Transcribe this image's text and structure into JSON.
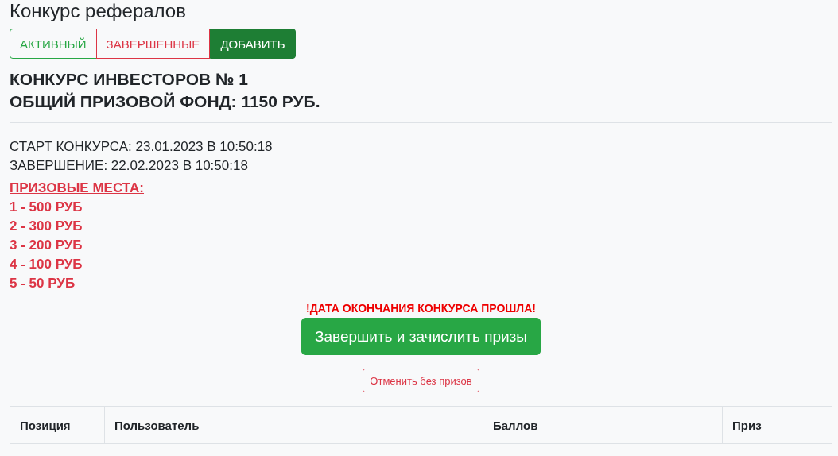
{
  "page": {
    "title": "Конкурс рефералов"
  },
  "nav_buttons": [
    {
      "label": "АКТИВНЫЙ",
      "kind": "outline-success"
    },
    {
      "label": "ЗАВЕРШЕННЫЕ",
      "kind": "outline-danger"
    },
    {
      "label": "ДОБАВИТЬ",
      "kind": "success"
    }
  ],
  "contest": {
    "name": "КОНКУРС ИНВЕСТОРОВ № 1",
    "prize_fund": "ОБЩИЙ ПРИЗОВОЙ ФОНД: 1150 РУБ.",
    "start": "СТАРТ КОНКУРСА: 23.01.2023 В 10:50:18",
    "end": "ЗАВЕРШЕНИЕ: 22.02.2023 В 10:50:18",
    "prizes_heading": "ПРИЗОВЫЕ МЕСТА:",
    "prizes": [
      "1 - 500 РУБ",
      "2 - 300 РУБ",
      "3 - 200 РУБ",
      "4 - 100 РУБ",
      "5 - 50 РУБ"
    ],
    "warning": "!ДАТА ОКОНЧАНИЯ КОНКУРСА ПРОШЛА!",
    "finish_button": "Завершить и зачислить призы",
    "cancel_button": "Отменить без призов"
  },
  "table": {
    "columns": [
      "Позиция",
      "Пользователь",
      "Баллов",
      "Приз"
    ]
  }
}
